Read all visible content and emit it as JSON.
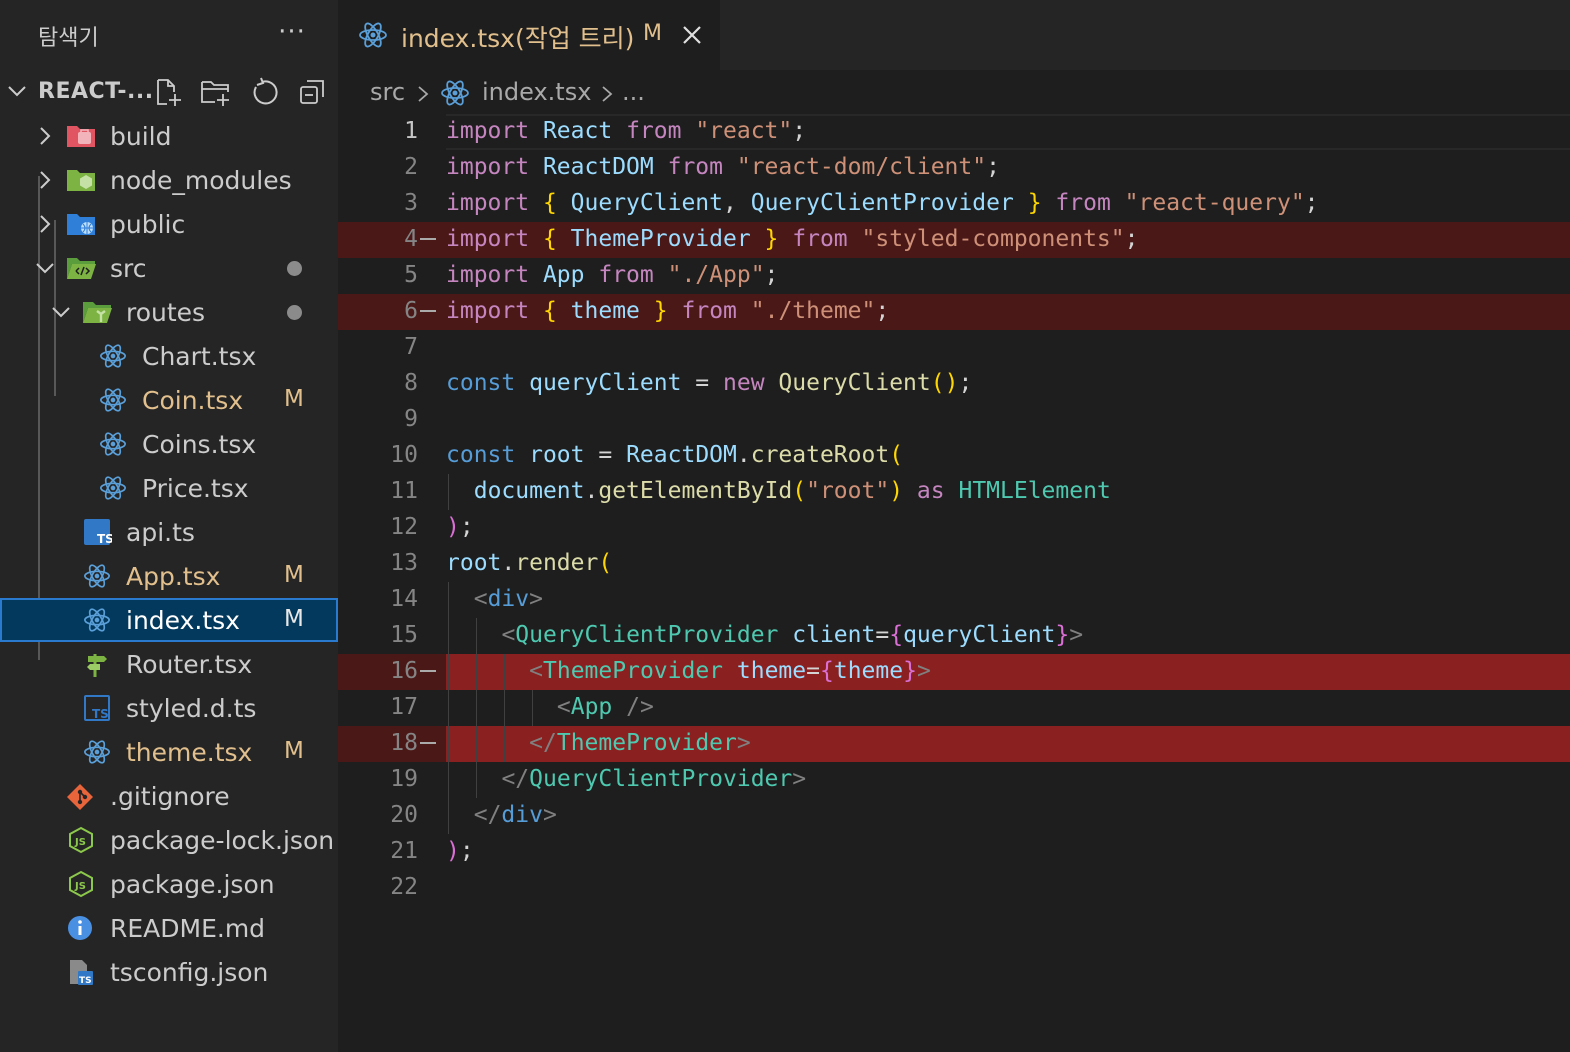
{
  "sidebar": {
    "title": "탐색기",
    "more_label": "···",
    "section_title": "REACT-...",
    "actions": [
      "new-file-icon",
      "new-folder-icon",
      "refresh-icon",
      "collapse-all-icon"
    ],
    "items": [
      {
        "label": "build",
        "kind": "folder",
        "icon": "folder-build-icon",
        "status": ""
      },
      {
        "label": "node_modules",
        "kind": "folder",
        "icon": "folder-node-icon",
        "status": ""
      },
      {
        "label": "public",
        "kind": "folder",
        "icon": "folder-public-icon",
        "status": ""
      },
      {
        "label": "src",
        "kind": "folder-open",
        "icon": "folder-src-icon",
        "status": "dot"
      },
      {
        "label": "routes",
        "kind": "folder-open",
        "icon": "folder-routes-icon",
        "status": "dot"
      },
      {
        "label": "Chart.tsx",
        "kind": "file",
        "icon": "react-icon",
        "status": ""
      },
      {
        "label": "Coin.tsx",
        "kind": "file",
        "icon": "react-icon",
        "status": "M"
      },
      {
        "label": "Coins.tsx",
        "kind": "file",
        "icon": "react-icon",
        "status": ""
      },
      {
        "label": "Price.tsx",
        "kind": "file",
        "icon": "react-icon",
        "status": ""
      },
      {
        "label": "api.ts",
        "kind": "file",
        "icon": "typescript-icon",
        "status": ""
      },
      {
        "label": "App.tsx",
        "kind": "file",
        "icon": "react-icon",
        "status": "M"
      },
      {
        "label": "index.tsx",
        "kind": "file",
        "icon": "react-icon",
        "status": "M"
      },
      {
        "label": "Router.tsx",
        "kind": "file",
        "icon": "router-icon",
        "status": ""
      },
      {
        "label": "styled.d.ts",
        "kind": "file",
        "icon": "typescript-def-icon",
        "status": ""
      },
      {
        "label": "theme.tsx",
        "kind": "file",
        "icon": "react-icon",
        "status": "M"
      },
      {
        "label": ".gitignore",
        "kind": "file",
        "icon": "git-icon",
        "status": ""
      },
      {
        "label": "package-lock.json",
        "kind": "file",
        "icon": "nodejs-icon",
        "status": ""
      },
      {
        "label": "package.json",
        "kind": "file",
        "icon": "nodejs-icon",
        "status": ""
      },
      {
        "label": "README.md",
        "kind": "file",
        "icon": "info-icon",
        "status": ""
      },
      {
        "label": "tsconfig.json",
        "kind": "file",
        "icon": "tsconfig-icon",
        "status": ""
      }
    ]
  },
  "tab": {
    "label": "index.tsx(작업 트리)",
    "modified": "M",
    "close_icon": "close-icon"
  },
  "breadcrumb": [
    "src",
    "index.tsx",
    "..."
  ],
  "editor": {
    "lines": [
      "import React from \"react\";",
      "import ReactDOM from \"react-dom/client\";",
      "import { QueryClient, QueryClientProvider } from \"react-query\";",
      "import { ThemeProvider } from \"styled-components\";",
      "import App from \"./App\";",
      "import { theme } from \"./theme\";",
      "",
      "const queryClient = new QueryClient();",
      "",
      "const root = ReactDOM.createRoot(",
      "  document.getElementById(\"root\") as HTMLElement",
      ");",
      "root.render(",
      "  <div>",
      "    <QueryClientProvider client={queryClient}>",
      "      <ThemeProvider theme={theme}>",
      "        <App />",
      "      </ThemeProvider>",
      "    </QueryClientProvider>",
      "  </div>",
      ");",
      ""
    ],
    "deleted_lines": [
      4,
      6,
      16,
      18
    ],
    "current_line": 1
  },
  "colors": {
    "modified": "#e2c08d",
    "deleted_bg": "#4b1818",
    "deleted_strong_bg": "#8b2020",
    "selection": "#04395e"
  }
}
